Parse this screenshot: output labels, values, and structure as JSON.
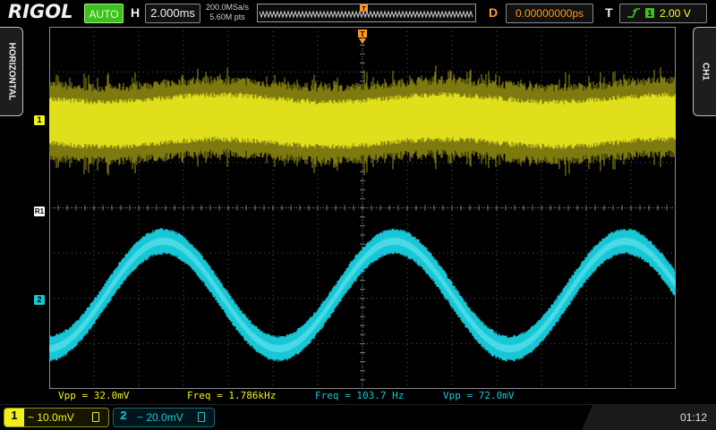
{
  "brand": "RIGOL",
  "topbar": {
    "run_mode": "AUTO",
    "horizontal_letter": "H",
    "timebase": "2.000ms",
    "sample_rate": "200.0MSa/s",
    "memory_depth": "5.60M pts",
    "delay_letter": "D",
    "delay": "0.00000000ps",
    "trigger_letter": "T",
    "trigger_level": "2.00 V"
  },
  "side_tabs": {
    "left": "HORIZONTAL",
    "right": "CH1"
  },
  "channel_markers": {
    "ch1": "1",
    "ch2": "2",
    "reference": "R1"
  },
  "measurements": {
    "ch1_vpp": "Vpp = 32.0mV",
    "ch1_freq": "Freq = 1.786kHz",
    "ch2_freq": "Freq = 103.7 Hz",
    "ch2_vpp": "Vpp = 72.0mV"
  },
  "bottombar": {
    "ch1_number": "1",
    "ch1_scale": "~ 10.0mV",
    "ch2_number": "2",
    "ch2_scale": "~ 20.0mV",
    "clock": "01:12"
  },
  "colors": {
    "ch1": "#f1f11d",
    "ch2": "#18c7d6",
    "trigger": "#ff9a1f",
    "auto_green": "#3fc01f",
    "grid": "#5a5a5a"
  },
  "icons": [
    "horizontal-position-marker",
    "trigger-edge-icon",
    "bandwidth-limit-icon"
  ]
}
